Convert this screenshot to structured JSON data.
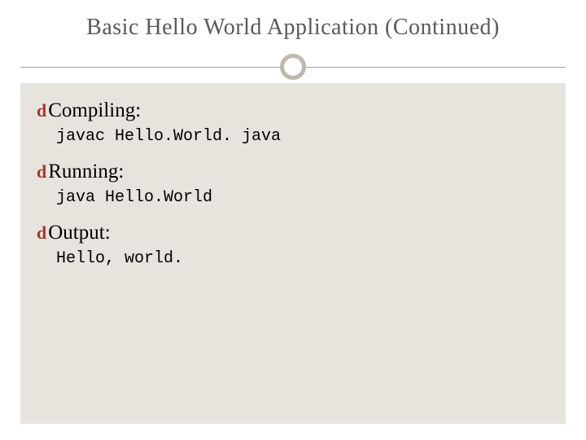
{
  "title": "Basic Hello World Application (Continued)",
  "sections": [
    {
      "heading": "Compiling:",
      "code": "javac Hello.World. java"
    },
    {
      "heading": "Running:",
      "code": "java Hello.World"
    },
    {
      "heading": "Output:",
      "code": "Hello, world."
    }
  ],
  "bullet_glyph": "d"
}
